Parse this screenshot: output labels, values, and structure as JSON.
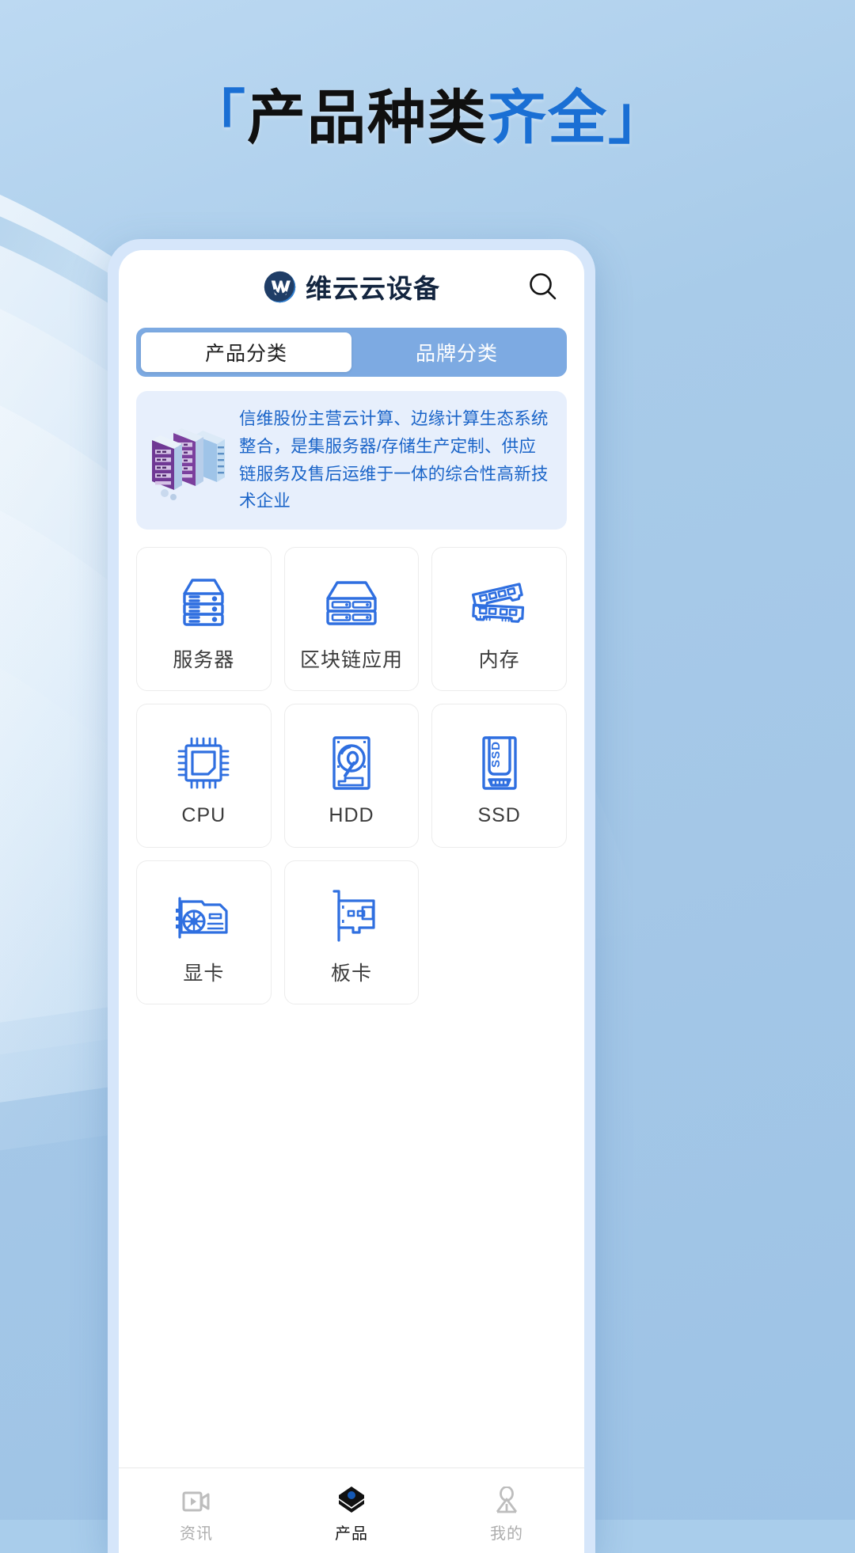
{
  "headline": {
    "bracket_open": "「",
    "part_dark": "产品种类",
    "part_blue": "齐全",
    "bracket_close": "」"
  },
  "app": {
    "brand_name": "维云云设备",
    "brand_mark_icon": "circular-w-logo-icon",
    "search_icon": "search-icon"
  },
  "tabs": [
    {
      "label": "产品分类",
      "active": true
    },
    {
      "label": "品牌分类",
      "active": false
    }
  ],
  "banner": {
    "illustration_icon": "server-rack-isometric-icon",
    "text": "信维股份主营云计算、边缘计算生态系统整合，是集服务器/存储生产定制、供应链服务及售后运维于一体的综合性高新技术企业"
  },
  "categories": [
    {
      "label": "服务器",
      "icon": "server-rack-icon"
    },
    {
      "label": "区块链应用",
      "icon": "blockchain-server-icon"
    },
    {
      "label": "内存",
      "icon": "memory-ram-icon"
    },
    {
      "label": "CPU",
      "icon": "cpu-chip-icon"
    },
    {
      "label": "HDD",
      "icon": "hard-disk-drive-icon"
    },
    {
      "label": "SSD",
      "icon": "solid-state-drive-icon"
    },
    {
      "label": "显卡",
      "icon": "graphics-card-icon"
    },
    {
      "label": "板卡",
      "icon": "expansion-board-card-icon"
    }
  ],
  "bottom_nav": [
    {
      "label": "资讯",
      "icon": "video-news-icon",
      "active": false
    },
    {
      "label": "产品",
      "icon": "layers-stack-icon",
      "active": true
    },
    {
      "label": "我的",
      "icon": "user-person-icon",
      "active": false
    }
  ],
  "colors": {
    "page_background": "#a9cdeb",
    "headline_blue": "#1a6fd4",
    "headline_dark": "#101010",
    "tab_bar_blue": "#7daae2",
    "banner_background": "#e7effc",
    "banner_text_blue": "#1a64c8",
    "icon_blue": "#2f6fe0",
    "brand_dark": "#13253f",
    "phone_frame": "#d6e6fa",
    "nav_inactive_gray": "#adadad",
    "nav_active_dark": "#141414"
  }
}
